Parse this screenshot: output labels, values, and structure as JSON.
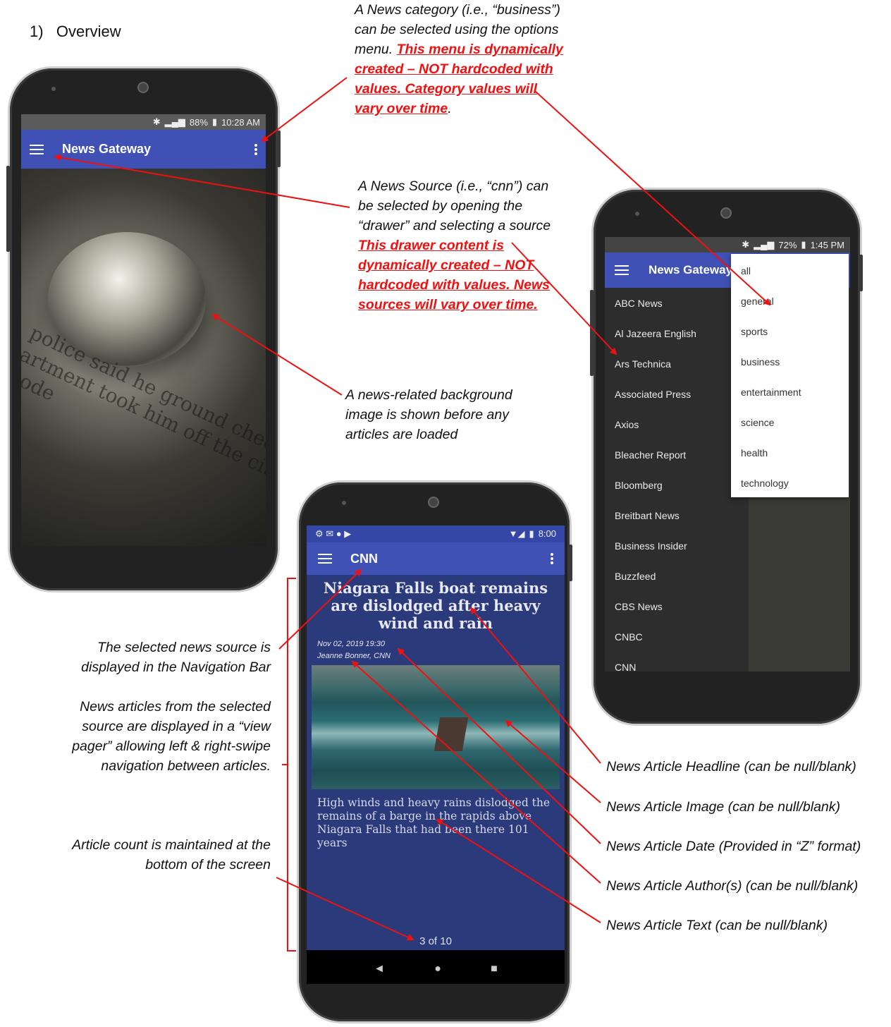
{
  "heading": "1)   Overview",
  "annotations": {
    "category_menu": {
      "text": "A News category (i.e., “business”) can be selected using the options menu.",
      "red": "This menu is dynamically created – NOT hardcoded with values. Category values will vary over time",
      "tail": "."
    },
    "source_drawer": {
      "text": "A News Source (i.e., “cnn”) can be selected by opening the “drawer” and selecting a source",
      "red": "This drawer content is dynamically created – NOT hardcoded with values. News sources will vary over time."
    },
    "background_image": "A news-related background image is shown before any articles are loaded",
    "selected_source": "The selected news source is displayed in the Navigation Bar",
    "view_pager": "News articles from the selected source are displayed in a “view pager” allowing left & right-swipe navigation between articles.",
    "article_count": "Article count is maintained at the bottom of the screen",
    "headline": "News Article Headline (can be null/blank)",
    "image": "News Article Image (can be null/blank)",
    "date": "News Article Date (Provided in “Z” format)",
    "author": "News Article Author(s) (can be null/blank)",
    "text": "News Article Text (can be null/blank)"
  },
  "phone1": {
    "status_right": "88%",
    "time": "10:28 AM",
    "title": "News Gateway",
    "newsprint": "police said he ground checks artment took him off the city code"
  },
  "phone2": {
    "status_right": "72%",
    "time": "1:45 PM",
    "title": "News Gateway",
    "sources": [
      "ABC News",
      "Al Jazeera English",
      "Ars Technica",
      "Associated Press",
      "Axios",
      "Bleacher Report",
      "Bloomberg",
      "Breitbart News",
      "Business Insider",
      "Buzzfeed",
      "CBS News",
      "CNBC",
      "CNN"
    ],
    "categories": [
      "all",
      "general",
      "sports",
      "business",
      "entertainment",
      "science",
      "health",
      "technology"
    ]
  },
  "phone3": {
    "time": "8:00",
    "title": "CNN",
    "headline": "Niagara Falls boat remains are dislodged after heavy wind and rain",
    "date": "Nov 02, 2019 19:30",
    "author": "Jeanne Bonner, CNN",
    "body": "High winds and heavy rains dislodged the remains of a barge in the rapids above Niagara Falls that had been there 101 years",
    "count": "3 of 10",
    "nav": {
      "back": "◄",
      "home": "●",
      "recents": "■"
    }
  },
  "colors": {
    "appbar": "#3f51b5",
    "article_bg": "#2b3a7a",
    "annotation_red": "#ee1111"
  }
}
